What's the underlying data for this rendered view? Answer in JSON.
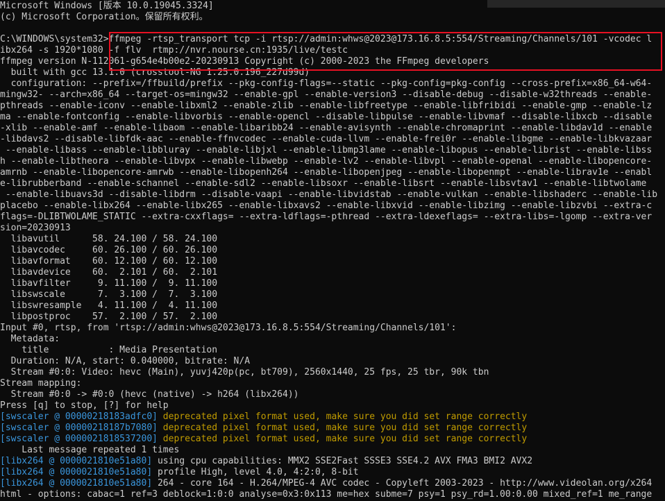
{
  "header": {
    "line1": "Microsoft Windows [版本 10.0.19045.3324]",
    "line2": "(c) Microsoft Corporation。保留所有权利。"
  },
  "command": {
    "line1": "C:\\WINDOWS\\system32>ffmpeg -rtsp_transport tcp -i rtsp://admin:whws@2023@173.16.8.5:554/Streaming/Channels/101 -vcodec l",
    "line2": "ibx264 -s 1920*1080 -f flv  rtmp://nvr.nourse.cn:1935/live/testc"
  },
  "build": {
    "version": "ffmpeg version N-112061-g654e4b00e2-20230913 Copyright (c) 2000-2023 the FFmpeg developers",
    "built_with": "  built with gcc 13.1.0 (crosstool-NG 1.25.0.196_227d99d)",
    "config_lines": [
      "  configuration: --prefix=/ffbuild/prefix --pkg-config-flags=--static --pkg-config=pkg-config --cross-prefix=x86_64-w64-",
      "mingw32- --arch=x86_64 --target-os=mingw32 --enable-gpl --enable-version3 --disable-debug --disable-w32threads --enable-",
      "pthreads --enable-iconv --enable-libxml2 --enable-zlib --enable-libfreetype --enable-libfribidi --enable-gmp --enable-lz",
      "ma --enable-fontconfig --enable-libvorbis --enable-opencl --disable-libpulse --enable-libvmaf --disable-libxcb --disable",
      "-xlib --enable-amf --enable-libaom --enable-libaribb24 --enable-avisynth --enable-chromaprint --enable-libdav1d --enable",
      "-libdavs2 --disable-libfdk-aac --enable-ffnvcodec --enable-cuda-llvm --enable-frei0r --enable-libgme --enable-libkvazaar",
      " --enable-libass --enable-libbluray --enable-libjxl --enable-libmp3lame --enable-libopus --enable-librist --enable-libss",
      "h --enable-libtheora --enable-libvpx --enable-libwebp --enable-lv2 --enable-libvpl --enable-openal --enable-libopencore-",
      "amrnb --enable-libopencore-amrwb --enable-libopenh264 --enable-libopenjpeg --enable-libopenmpt --enable-librav1e --enabl",
      "e-librubberband --enable-schannel --enable-sdl2 --enable-libsoxr --enable-libsrt --enable-libsvtav1 --enable-libtwolame",
      " --enable-libuavs3d --disable-libdrm --disable-vaapi --enable-libvidstab --enable-vulkan --enable-libshaderc --enable-lib",
      "placebo --enable-libx264 --enable-libx265 --enable-libxavs2 --enable-libxvid --enable-libzimg --enable-libzvbi --extra-c",
      "flags=-DLIBTWOLAME_STATIC --extra-cxxflags= --extra-ldflags=-pthread --extra-ldexeflags= --extra-libs=-lgomp --extra-ver",
      "sion=20230913"
    ]
  },
  "libs": [
    "  libavutil      58. 24.100 / 58. 24.100",
    "  libavcodec     60. 26.100 / 60. 26.100",
    "  libavformat    60. 12.100 / 60. 12.100",
    "  libavdevice    60.  2.101 / 60.  2.101",
    "  libavfilter     9. 11.100 /  9. 11.100",
    "  libswscale      7.  3.100 /  7.  3.100",
    "  libswresample   4. 11.100 /  4. 11.100",
    "  libpostproc    57.  2.100 / 57.  2.100"
  ],
  "input": {
    "line": "Input #0, rtsp, from 'rtsp://admin:whws@2023@173.16.8.5:554/Streaming/Channels/101':",
    "metadata": "  Metadata:",
    "title": "    title           : Media Presentation",
    "duration": "  Duration: N/A, start: 0.040000, bitrate: N/A",
    "stream": "  Stream #0:0: Video: hevc (Main), yuvj420p(pc, bt709), 2560x1440, 25 fps, 25 tbr, 90k tbn"
  },
  "mapping": {
    "header": "Stream mapping:",
    "line": "  Stream #0:0 -> #0:0 (hevc (native) -> h264 (libx264))",
    "press": "Press [q] to stop, [?] for help"
  },
  "swscaler": [
    {
      "tag": "[swscaler @ 00000218183adfc0]",
      "msg": " deprecated pixel format used, make sure you did set range correctly"
    },
    {
      "tag": "[swscaler @ 00000218187b7080]",
      "msg": " deprecated pixel format used, make sure you did set range correctly"
    },
    {
      "tag": "[swscaler @ 0000021818537200]",
      "msg": " deprecated pixel format used, make sure you did set range correctly"
    }
  ],
  "repeated": "    Last message repeated 1 times",
  "x264": [
    {
      "tag": "[libx264 @ 0000021810e51a80]",
      "msg": " using cpu capabilities: MMX2 SSE2Fast SSSE3 SSE4.2 AVX FMA3 BMI2 AVX2"
    },
    {
      "tag": "[libx264 @ 0000021810e51a80]",
      "msg": " profile High, level 4.0, 4:2:0, 8-bit"
    },
    {
      "tag": "[libx264 @ 0000021810e51a80]",
      "msg": " 264 - core 164 - H.264/MPEG-4 AVC codec - Copyleft 2003-2023 - http://www.videolan.org/x264"
    }
  ],
  "last_partial": "html - options: cabac=1 ref=3 deblock=1:0:0 analyse=0x3:0x113 me=hex subme=7 psy=1 psy_rd=1.00:0.00 mixed_ref=1 me_range",
  "colors": {
    "background": "#0c0c0c",
    "text": "#cccccc",
    "tag": "#3a96dd",
    "warning": "#c19c00",
    "highlight_border": "#e81123"
  }
}
